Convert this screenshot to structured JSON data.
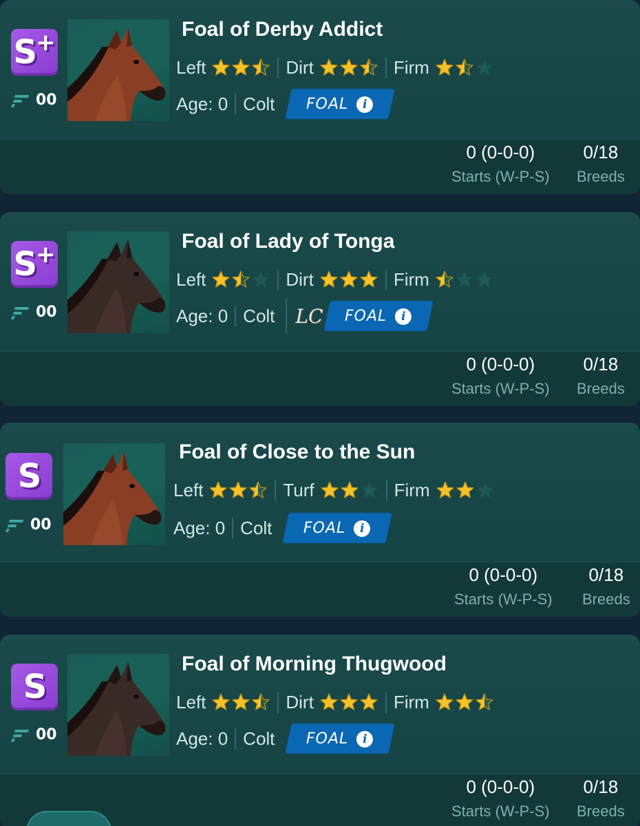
{
  "colors": {
    "star_filled": "#f5c22a",
    "star_empty": "#1e5a58",
    "foal_button": "#0a67b3",
    "grade_badge": "#9b4be0"
  },
  "icons": {
    "speed": "speed-stripes-icon",
    "info": "info-icon",
    "star": "star-icon"
  },
  "horses": [
    {
      "grade": "S",
      "grade_plus": "+",
      "speed": "00",
      "name": "Foal of Derby Addict",
      "attributes": [
        {
          "label": "Left",
          "stars": 2.5
        },
        {
          "label": "Dirt",
          "stars": 2.5
        },
        {
          "label": "Firm",
          "stars": 1.5
        }
      ],
      "age": "Age: 0",
      "sex": "Colt",
      "badge": "",
      "foal_label": "FOAL",
      "starts_value": "0 (0-0-0)",
      "starts_label": "Starts (W-P-S)",
      "breeds_value": "0/18",
      "breeds_label": "Breeds",
      "coat": "bay"
    },
    {
      "grade": "S",
      "grade_plus": "+",
      "speed": "00",
      "name": "Foal of Lady of Tonga",
      "attributes": [
        {
          "label": "Left",
          "stars": 1.5
        },
        {
          "label": "Dirt",
          "stars": 3
        },
        {
          "label": "Firm",
          "stars": 0.5
        }
      ],
      "age": "Age: 0",
      "sex": "Colt",
      "badge": "LC",
      "foal_label": "FOAL",
      "starts_value": "0 (0-0-0)",
      "starts_label": "Starts (W-P-S)",
      "breeds_value": "0/18",
      "breeds_label": "Breeds",
      "coat": "dark"
    },
    {
      "grade": "S",
      "grade_plus": "",
      "speed": "00",
      "name": "Foal of Close to the Sun",
      "attributes": [
        {
          "label": "Left",
          "stars": 2.5
        },
        {
          "label": "Turf",
          "stars": 2
        },
        {
          "label": "Firm",
          "stars": 2
        }
      ],
      "age": "Age: 0",
      "sex": "Colt",
      "badge": "",
      "foal_label": "FOAL",
      "starts_value": "0 (0-0-0)",
      "starts_label": "Starts (W-P-S)",
      "breeds_value": "0/18",
      "breeds_label": "Breeds",
      "coat": "bay"
    },
    {
      "grade": "S",
      "grade_plus": "",
      "speed": "00",
      "name": "Foal of Morning Thugwood",
      "attributes": [
        {
          "label": "Left",
          "stars": 2.5
        },
        {
          "label": "Dirt",
          "stars": 3
        },
        {
          "label": "Firm",
          "stars": 2.5
        }
      ],
      "age": "Age: 0",
      "sex": "Colt",
      "badge": "",
      "foal_label": "FOAL",
      "starts_value": "0 (0-0-0)",
      "starts_label": "Starts (W-P-S)",
      "breeds_value": "0/18",
      "breeds_label": "Breeds",
      "coat": "dark"
    }
  ]
}
